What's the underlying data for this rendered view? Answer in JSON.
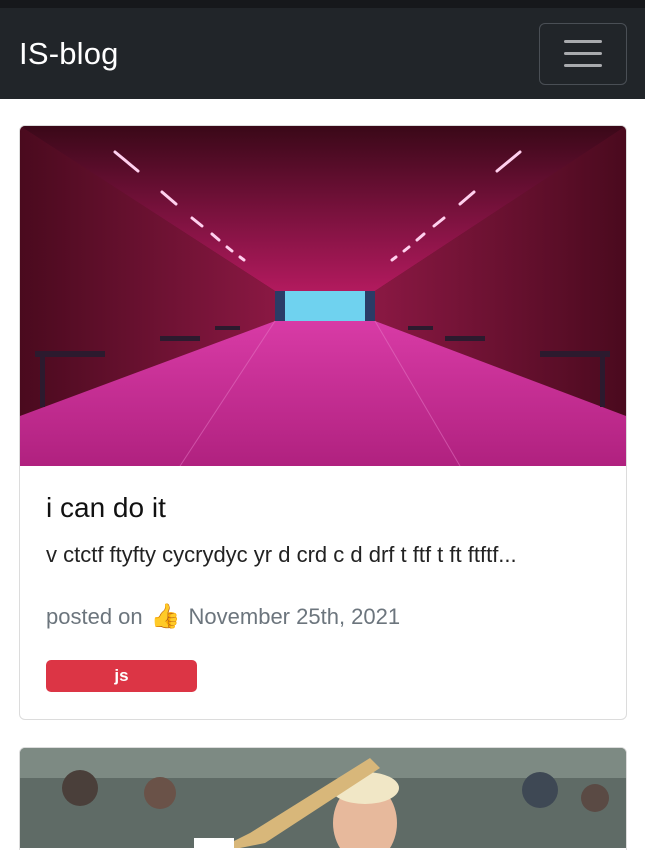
{
  "navbar": {
    "brand": "IS-blog"
  },
  "posts": [
    {
      "title": "i can do it",
      "excerpt": "v ctctf ftyfty cycrydyc yr d crd c d drf t ftf t ft ftftf...",
      "posted_prefix": "posted on",
      "date": "November 25th, 2021",
      "tag": "js",
      "image_icon": "tunnel-photo"
    },
    {
      "image_icon": "cricket-player-photo"
    }
  ],
  "colors": {
    "navbar_bg": "#212529",
    "badge_bg": "#dc3545",
    "meta_text": "#6c757d"
  }
}
